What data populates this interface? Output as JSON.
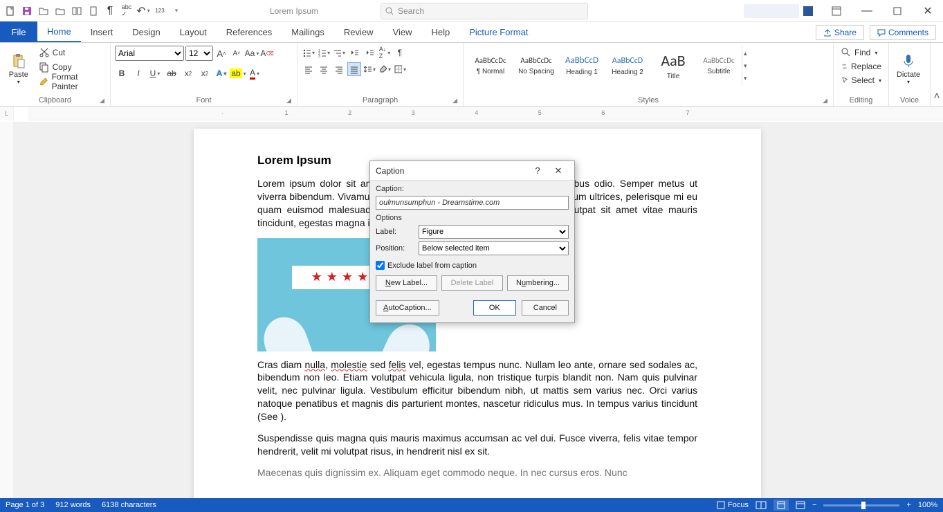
{
  "title_bar": {
    "doc_title": "Lorem Ipsum",
    "search_placeholder": "Search"
  },
  "tabs": {
    "file": "File",
    "items": [
      "Home",
      "Insert",
      "Design",
      "Layout",
      "References",
      "Mailings",
      "Review",
      "View",
      "Help"
    ],
    "ctx": "Picture Format",
    "share": "Share",
    "comments": "Comments"
  },
  "ribbon": {
    "clipboard": {
      "paste": "Paste",
      "cut": "Cut",
      "copy": "Copy",
      "format_painter": "Format Painter",
      "label": "Clipboard"
    },
    "font": {
      "name": "Arial",
      "size": "12",
      "label": "Font"
    },
    "paragraph": {
      "label": "Paragraph"
    },
    "styles": {
      "label": "Styles",
      "items": [
        {
          "preview": "AaBbCcDc",
          "name": "¶ Normal",
          "size": "11px",
          "color": "#333"
        },
        {
          "preview": "AaBbCcDc",
          "name": "No Spacing",
          "size": "11px",
          "color": "#333"
        },
        {
          "preview": "AaBbCcD",
          "name": "Heading 1",
          "size": "13px",
          "color": "#2e74b5"
        },
        {
          "preview": "AaBbCcD",
          "name": "Heading 2",
          "size": "12px",
          "color": "#2e74b5"
        },
        {
          "preview": "AaB",
          "name": "Title",
          "size": "22px",
          "color": "#333"
        },
        {
          "preview": "AaBbCcDc",
          "name": "Subtitle",
          "size": "11px",
          "color": "#777"
        }
      ]
    },
    "editing": {
      "find": "Find",
      "replace": "Replace",
      "select": "Select",
      "label": "Editing"
    },
    "voice": {
      "dictate": "Dictate",
      "label": "Voice"
    }
  },
  "document": {
    "heading": "Lorem Ipsum",
    "p1": "Lorem ipsum dolor sit amet, consectetur adipiscing elit. Nunc ac faucibus odio. Semper metus ut viverra bibendum. Vivamus e vestibulum magna urna, volutpat in vestibulum ultrices, pelerisque mi eu quam euismod malesuada. Donec sed facilisis felis. Aliquam erat volutpat sit amet vitae mauris tincidunt, egestas magna in, hendrerit est.",
    "p2_a": "Cras diam ",
    "p2_w1": "nulla",
    "p2_b": ", ",
    "p2_w2": "molestie",
    "p2_c": " sed ",
    "p2_w3": "felis",
    "p2_d": " vel, egestas tempus nunc. Nullam leo ante, ornare sed sodales ac, bibendum non leo. Etiam volutpat vehicula ligula, non tristique turpis blandit non. Nam quis pulvinar velit, nec pulvinar ligula. Vestibulum efficitur bibendum nibh, ut mattis sem varius nec. Orci varius natoque penatibus et magnis dis parturient montes, nascetur ridiculus mus. In tempus varius tincidunt (See ).",
    "p3": "Suspendisse quis magna quis mauris maximus accumsan ac vel dui. Fusce viverra, felis vitae tempor hendrerit, velit mi volutpat risus, in hendrerit nisl ex sit.",
    "p4": "Maecenas quis dignissim ex. Aliquam eget commodo neque. In nec cursus eros. Nunc"
  },
  "dialog": {
    "title": "Caption",
    "caption_lbl": "Caption:",
    "caption_value": "oulmunsumphun - Dreamstime.com",
    "options_lbl": "Options",
    "label_lbl": "Label:",
    "label_value": "Figure",
    "position_lbl": "Position:",
    "position_value": "Below selected item",
    "exclude": "Exclude label from caption",
    "new_label": "New Label...",
    "delete_label": "Delete Label",
    "numbering": "Numbering...",
    "autocaption": "AutoCaption...",
    "ok": "OK",
    "cancel": "Cancel"
  },
  "status": {
    "page": "Page 1 of 3",
    "words": "912 words",
    "chars": "6138 characters",
    "focus": "Focus",
    "zoom": "100%"
  }
}
